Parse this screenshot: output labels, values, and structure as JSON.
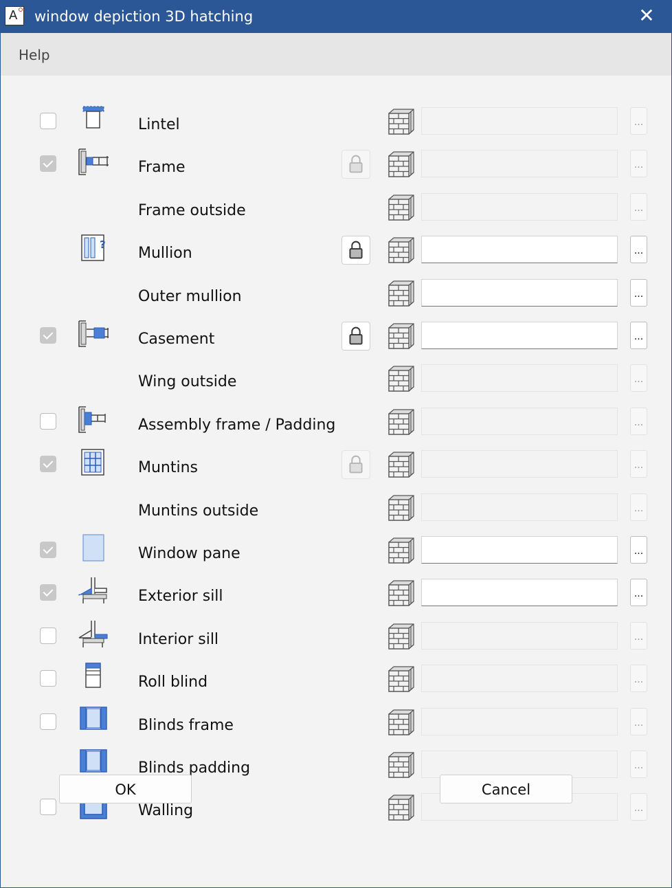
{
  "window": {
    "title": "window depiction 3D hatching",
    "app_icon_letter": "A"
  },
  "menu": {
    "help": "Help"
  },
  "rows": [
    {
      "label": "Lintel",
      "checkbox": "unchecked",
      "icon": "lintel-icon",
      "lock": "none",
      "field_active": false
    },
    {
      "label": "Frame",
      "checkbox": "checked-disabled",
      "icon": "frame-icon",
      "lock": "disabled",
      "field_active": false
    },
    {
      "label": "Frame outside",
      "checkbox": "none",
      "icon": "none",
      "lock": "none",
      "field_active": false
    },
    {
      "label": "Mullion",
      "checkbox": "none",
      "icon": "mullion-icon",
      "lock": "enabled",
      "field_active": true
    },
    {
      "label": "Outer mullion",
      "checkbox": "none",
      "icon": "none",
      "lock": "none",
      "field_active": true
    },
    {
      "label": "Casement",
      "checkbox": "checked-disabled",
      "icon": "casement-icon",
      "lock": "enabled",
      "field_active": true
    },
    {
      "label": "Wing outside",
      "checkbox": "none",
      "icon": "none",
      "lock": "none",
      "field_active": false
    },
    {
      "label": "Assembly frame / Padding",
      "checkbox": "unchecked",
      "icon": "assembly-frame-icon",
      "lock": "none",
      "field_active": false
    },
    {
      "label": "Muntins",
      "checkbox": "checked-disabled",
      "icon": "muntins-icon",
      "lock": "disabled",
      "field_active": false
    },
    {
      "label": "Muntins outside",
      "checkbox": "none",
      "icon": "none",
      "lock": "none",
      "field_active": false
    },
    {
      "label": "Window pane",
      "checkbox": "checked-disabled",
      "icon": "window-pane-icon",
      "lock": "none",
      "field_active": true
    },
    {
      "label": "Exterior sill",
      "checkbox": "checked-disabled",
      "icon": "exterior-sill-icon",
      "lock": "none",
      "field_active": true
    },
    {
      "label": "Interior sill",
      "checkbox": "unchecked",
      "icon": "interior-sill-icon",
      "lock": "none",
      "field_active": false
    },
    {
      "label": "Roll blind",
      "checkbox": "unchecked",
      "icon": "roll-blind-icon",
      "lock": "none",
      "field_active": false
    },
    {
      "label": "Blinds frame",
      "checkbox": "unchecked",
      "icon": "blinds-frame-icon",
      "lock": "none",
      "field_active": false
    },
    {
      "label": "Blinds padding",
      "checkbox": "none",
      "icon": "blinds-padding-icon",
      "lock": "none",
      "field_active": false
    },
    {
      "label": "Walling",
      "checkbox": "unchecked",
      "icon": "walling-icon",
      "lock": "none",
      "field_active": false
    }
  ],
  "browse_label": "...",
  "buttons": {
    "ok": "OK",
    "cancel": "Cancel"
  },
  "colors": {
    "titlebar": "#2b5797",
    "accent_blue": "#4a7fd4",
    "light_blue": "#cfe0f7"
  }
}
